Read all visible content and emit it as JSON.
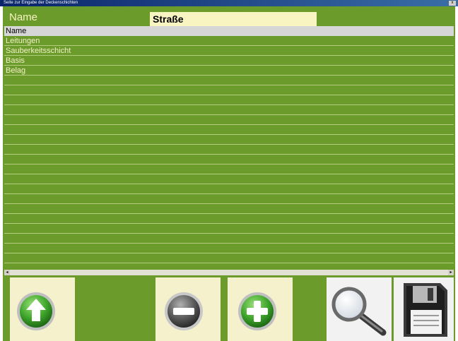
{
  "window": {
    "title": "Seite zur Eingabe der Deckenschichten",
    "close_label": "x"
  },
  "form": {
    "name_label": "Name",
    "name_value": "Straße"
  },
  "grid": {
    "header": "Name",
    "rows": [
      "Leitungen",
      "Sauberkeitsschicht",
      "Basis",
      "Belag"
    ]
  },
  "toolbar": {
    "buttons": [
      {
        "name": "move-up-button",
        "icon": "arrow-up-icon"
      },
      {
        "name": "remove-button",
        "icon": "minus-icon"
      },
      {
        "name": "add-button",
        "icon": "plus-icon"
      },
      {
        "name": "search-button",
        "icon": "magnifier-icon"
      },
      {
        "name": "save-button",
        "icon": "floppy-disk-icon"
      }
    ]
  },
  "colors": {
    "background_green": "#6b9b2a",
    "row_line": "#b4cd7e",
    "input_background": "#f8f5c2",
    "header_gray": "#d6d6d6"
  }
}
